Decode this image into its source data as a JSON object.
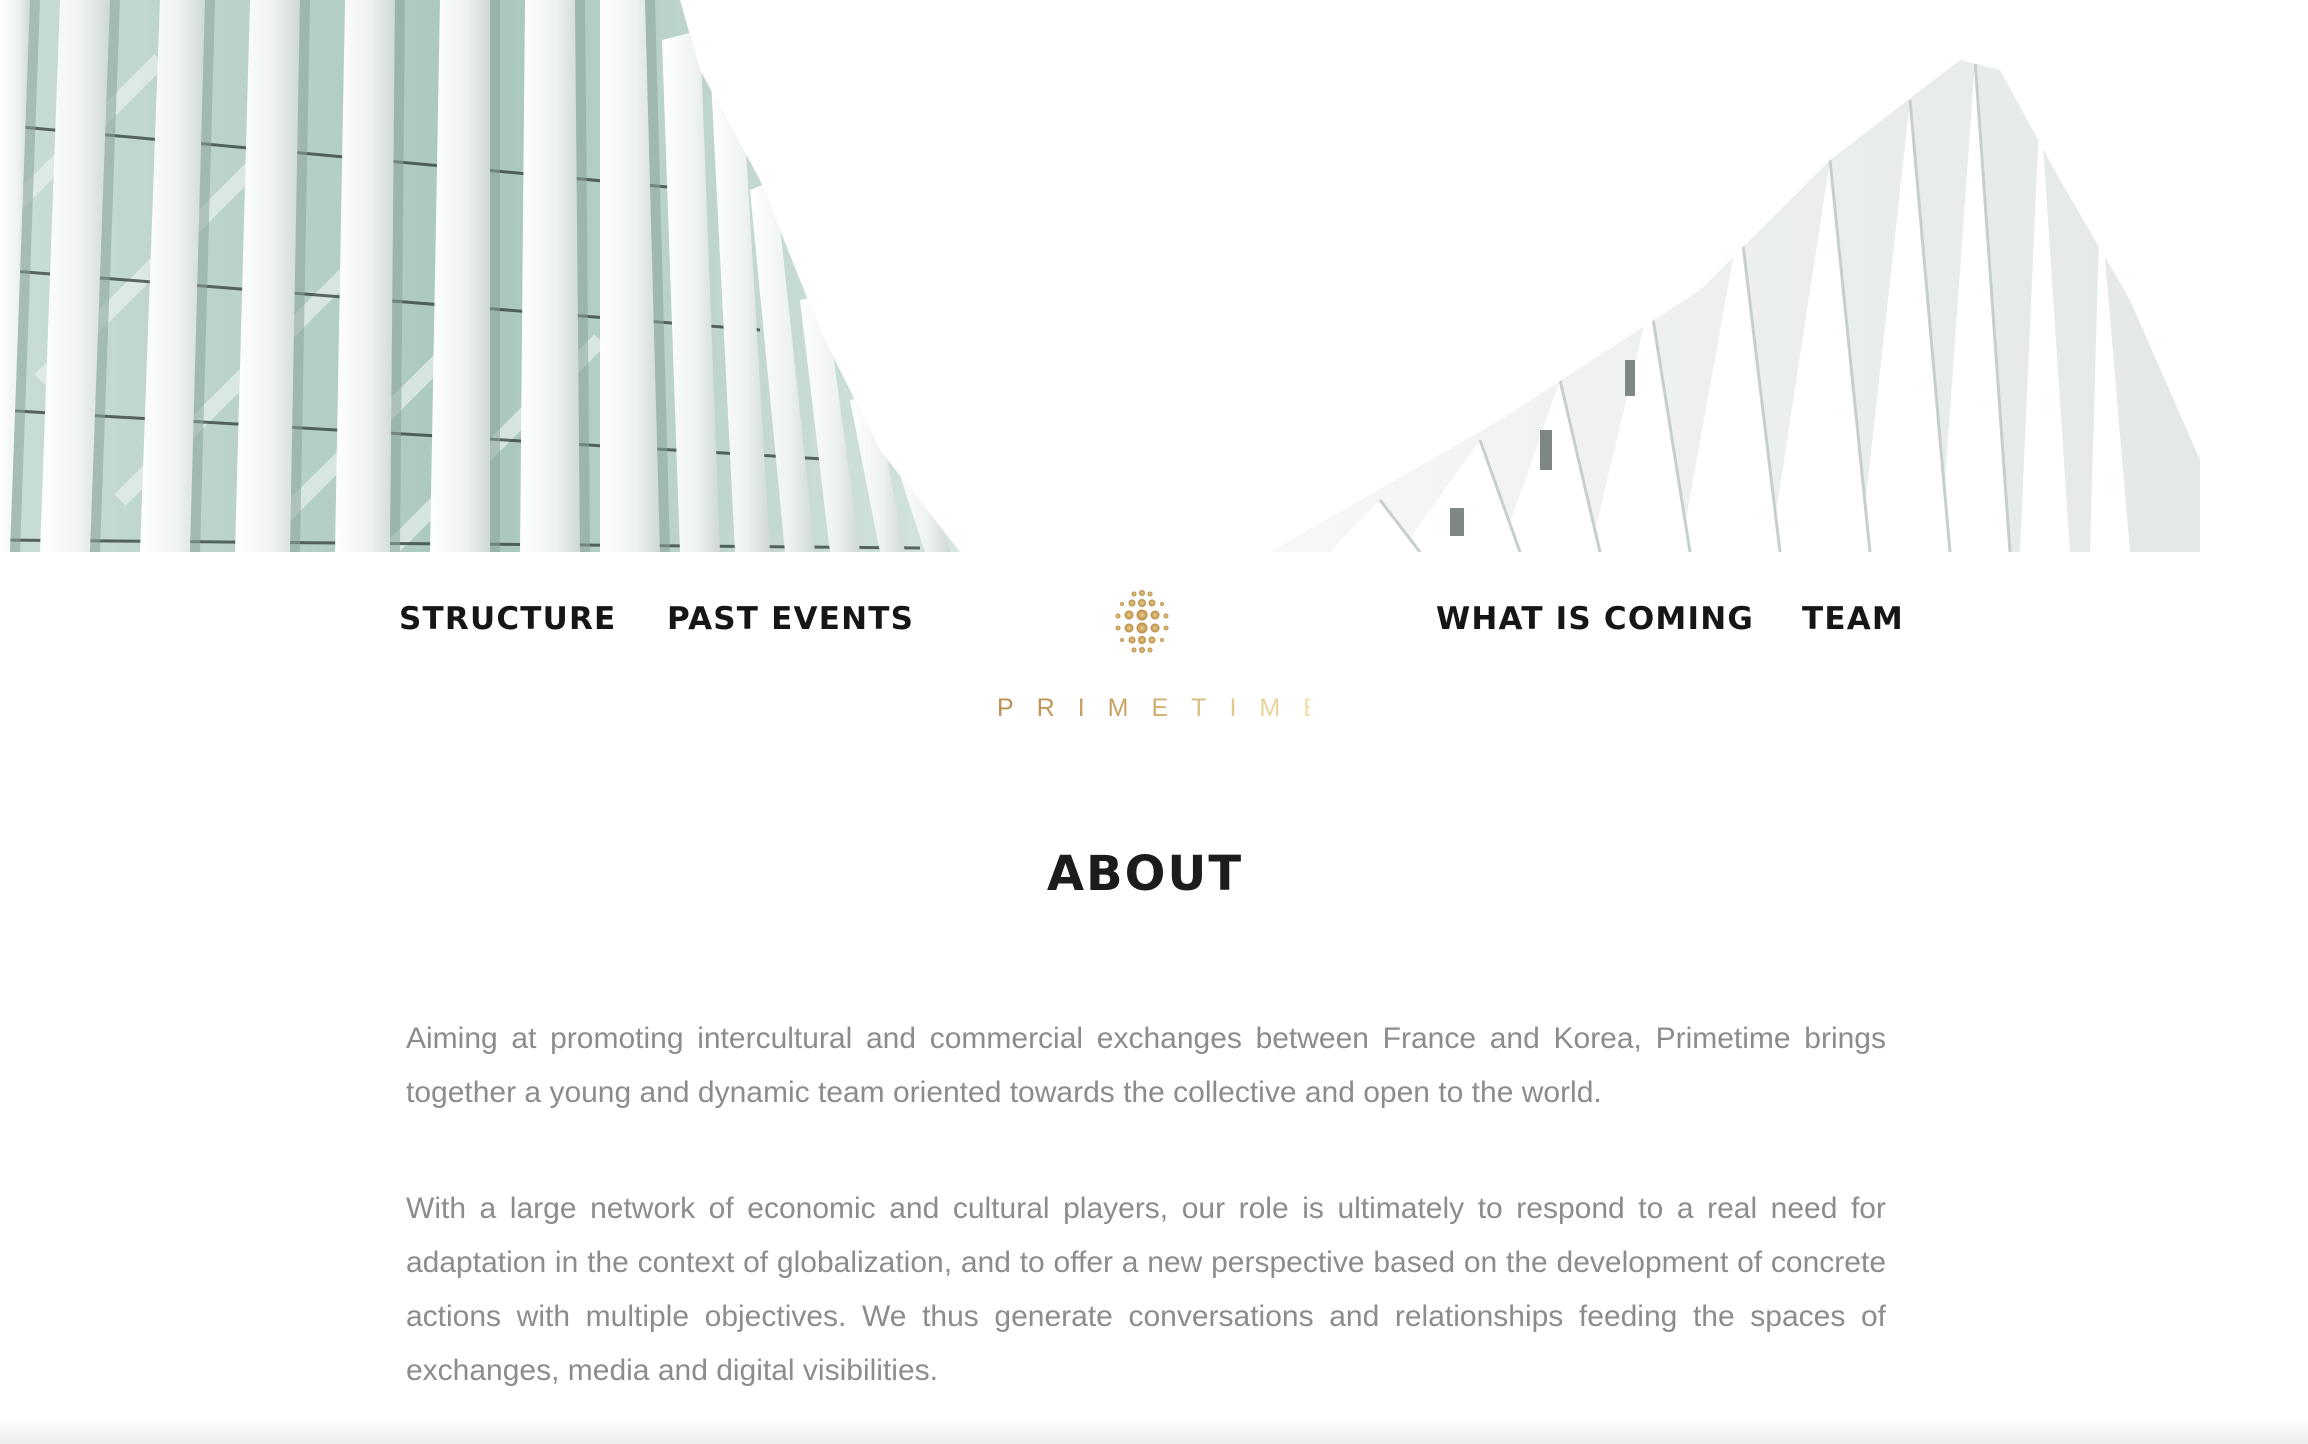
{
  "nav": {
    "left": [
      {
        "label": "STRUCTURE"
      },
      {
        "label": "PAST EVENTS"
      }
    ],
    "right": [
      {
        "label": "WHAT IS COMING"
      },
      {
        "label": "TEAM"
      }
    ],
    "logo_text": "PRIMETIME"
  },
  "about": {
    "title": "ABOUT",
    "paragraphs": [
      "Aiming at promoting intercultural and commercial exchanges between France and Korea, Primetime brings together a young and dynamic team oriented towards the collective and open to the world.",
      "With a large network of economic and cultural players, our role is ultimately to respond to a real need for adaptation in the context of globalization, and to offer a new perspective based on the development of concrete actions with multiple objectives. We thus generate conversations and relationships feeding the spaces of exchanges, media and digital visibilities."
    ]
  },
  "colors": {
    "logo_gold_start": "#b78a4e",
    "logo_gold_end": "#efe1a8",
    "nav_text": "#161616",
    "body_text": "#8c8c8c"
  },
  "icons": {
    "logo_mark": "dot-cluster-logo-icon",
    "hero_image": "white-architecture-facade-image"
  }
}
